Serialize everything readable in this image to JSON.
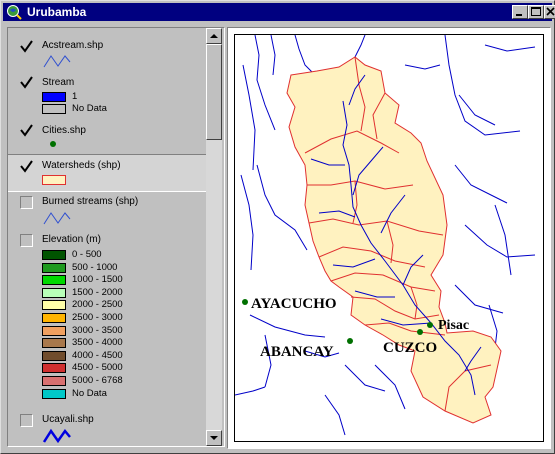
{
  "window": {
    "title": "Urubamba"
  },
  "toc": {
    "layers": [
      {
        "name": "Acstream.shp",
        "checked": true
      },
      {
        "name": "Stream",
        "checked": true,
        "legend": [
          {
            "label": "1",
            "color": "#0000ff"
          },
          {
            "label": "No Data",
            "color": "#c0c0c0"
          }
        ]
      },
      {
        "name": "Cities.shp",
        "checked": true
      },
      {
        "name": "Watersheds (shp)",
        "checked": true
      },
      {
        "name": "Burned streams (shp)",
        "checked": false
      },
      {
        "name": "Elevation (m)",
        "checked": false,
        "legend": [
          {
            "label": "0 - 500",
            "color": "#005400"
          },
          {
            "label": "500 - 1000",
            "color": "#1f9a1f"
          },
          {
            "label": "1000 - 1500",
            "color": "#00d800"
          },
          {
            "label": "1500 - 2000",
            "color": "#b8ffb8"
          },
          {
            "label": "2000 - 2500",
            "color": "#ffffa8"
          },
          {
            "label": "2500 - 3000",
            "color": "#ffb400"
          },
          {
            "label": "3000 - 3500",
            "color": "#f0a060"
          },
          {
            "label": "3500 - 4000",
            "color": "#a8784c"
          },
          {
            "label": "4000 - 4500",
            "color": "#704c2c"
          },
          {
            "label": "4500 - 5000",
            "color": "#d03030"
          },
          {
            "label": "5000 - 6768",
            "color": "#d87070"
          },
          {
            "label": "No Data",
            "color": "#00c8c8"
          }
        ]
      },
      {
        "name": "Ucayali.shp",
        "checked": false
      }
    ]
  },
  "map": {
    "cities": [
      "AYACUCHO",
      "ABANCAY",
      "CUZCO",
      "Pisac"
    ],
    "colors": {
      "stream": "#0000c8",
      "watershed_fill": "#fff2c0",
      "watershed_line": "#e03030",
      "city": "#007000"
    }
  }
}
